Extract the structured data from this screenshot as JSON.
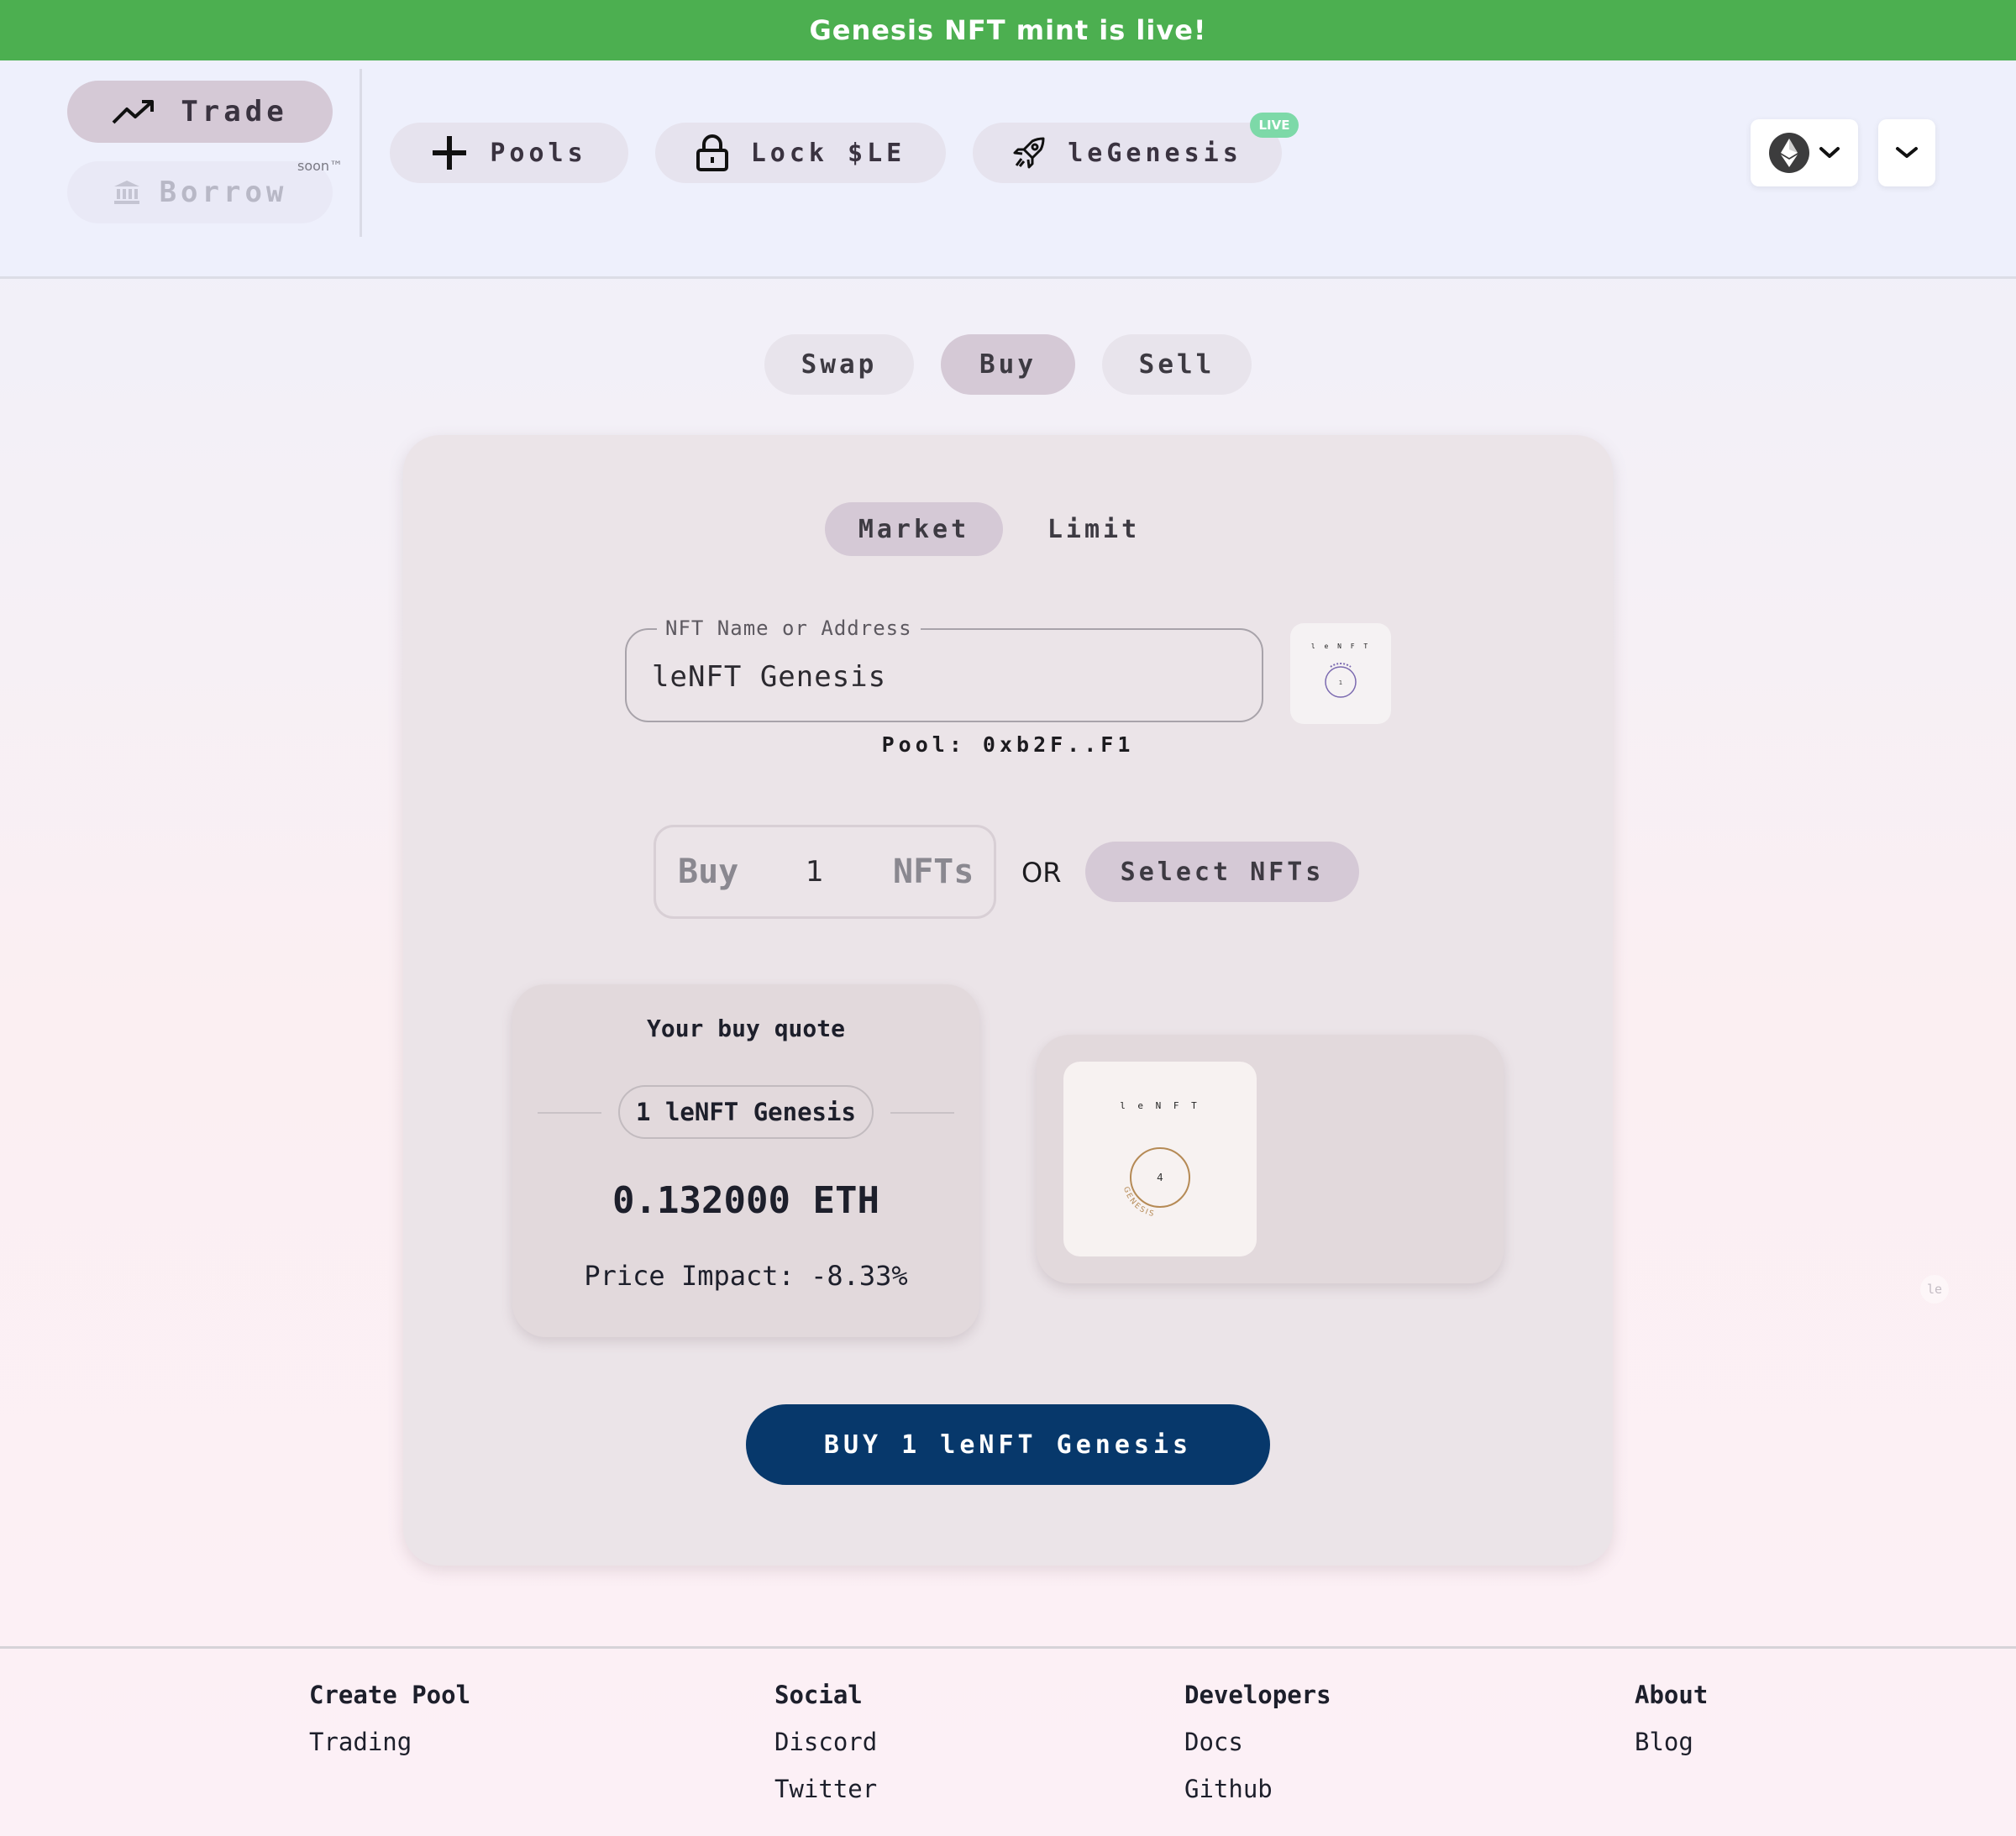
{
  "banner": {
    "text": "Genesis NFT mint is live!"
  },
  "nav": {
    "trade": "Trade",
    "borrow": "Borrow",
    "borrow_tag": "soon™",
    "pools": "Pools",
    "lock": "Lock $LE",
    "legenesis": "leGenesis",
    "live_badge": "LIVE"
  },
  "modes": {
    "swap": "Swap",
    "buy": "Buy",
    "sell": "Sell",
    "active": "Buy"
  },
  "order_types": {
    "market": "Market",
    "limit": "Limit",
    "active": "Market"
  },
  "nft_field": {
    "label": "NFT Name or Address",
    "value": "leNFT Genesis"
  },
  "pool": "Pool: 0xb2F..F1",
  "quantity": {
    "prefix": "Buy",
    "value": "1",
    "suffix": "NFTs"
  },
  "or_text": "OR",
  "select_nfts": "Select NFTs",
  "quote": {
    "title": "Your buy quote",
    "item": "1 leNFT Genesis",
    "price": "0.132000 ETH",
    "impact": "Price Impact: -8.33%"
  },
  "nft_preview": {
    "title": "l e N F T",
    "number": "4",
    "arc_text": "GENESIS"
  },
  "thumb": {
    "title": "l e N F T",
    "number": "1"
  },
  "cta": "BUY 1 leNFT Genesis",
  "side_badge": "le",
  "footer": {
    "columns": [
      {
        "title": "Create Pool",
        "links": [
          "Trading"
        ]
      },
      {
        "title": "Social",
        "links": [
          "Discord",
          "Twitter"
        ]
      },
      {
        "title": "Developers",
        "links": [
          "Docs",
          "Github"
        ]
      },
      {
        "title": "About",
        "links": [
          "Blog"
        ]
      }
    ]
  },
  "colors": {
    "banner": "#4caf50",
    "cta": "#07386b",
    "active_pill": "#d5c9d6",
    "live": "#7dd9a8"
  },
  "icons": [
    "trending-up-icon",
    "bank-icon",
    "plus-icon",
    "lock-icon",
    "rocket-icon",
    "ethereum-icon",
    "chevron-down-icon"
  ]
}
